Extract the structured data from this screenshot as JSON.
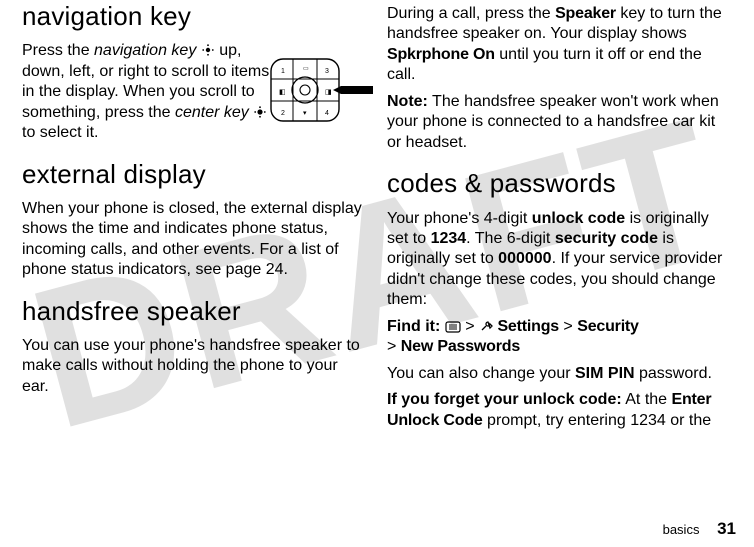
{
  "watermark": "DRAFT",
  "left": {
    "h_nav": "navigation key",
    "p_nav_1a": "Press the ",
    "p_nav_1b": "navigation key",
    "p_nav_1c": " up, down, left, or right to scroll to items in the display. When you scroll to something, press the ",
    "p_nav_1d": "center key",
    "p_nav_1e": " to select it.",
    "h_ext": "external display",
    "p_ext": "When your phone is closed, the external display shows the time and indicates phone status, incoming calls, and other events. For a list of phone status indicators, see page 24.",
    "h_hands": "handsfree speaker",
    "p_hands": "You can use your phone's handsfree speaker to make calls without holding the phone to your ear."
  },
  "right": {
    "p_speaker_a": "During a call, press the ",
    "p_speaker_b": "Speaker",
    "p_speaker_c": " key to turn the handsfree speaker on. Your display shows ",
    "p_speaker_d": "Spkrphone On",
    "p_speaker_e": " until you turn it off or end the call.",
    "p_note_a": "Note:",
    "p_note_b": " The handsfree speaker won't work when your phone is connected to a handsfree car kit or headset.",
    "h_codes": "codes & passwords",
    "p_codes_a": "Your phone's 4-digit ",
    "p_codes_b": "unlock code",
    "p_codes_c": " is originally set to ",
    "p_codes_d": "1234",
    "p_codes_e": ". The 6-digit ",
    "p_codes_f": "security code",
    "p_codes_g": " is originally set to ",
    "p_codes_h": "000000",
    "p_codes_i": ". If your service provider didn't change these codes, you should change them:",
    "p_find_a": "Find it:",
    "p_find_menu_sep1": " > ",
    "p_find_settings": "Settings",
    "p_find_sep2": " > ",
    "p_find_security": "Security",
    "p_find_sep3": " > ",
    "p_find_newpw": "New Passwords",
    "p_sim_a": "You can also change your ",
    "p_sim_b": "SIM PIN",
    "p_sim_c": " password.",
    "p_forget_a": "If you forget your unlock code:",
    "p_forget_b": " At the ",
    "p_forget_c": "Enter Unlock Code",
    "p_forget_d": " prompt, try entering 1234 or the"
  },
  "footer": {
    "section": "basics",
    "page": "31"
  },
  "icons": {
    "nav_dot": "nav-dot-icon",
    "center_key": "center-key-icon",
    "menu_key": "menu-key-icon",
    "tools": "tools-icon",
    "navpad": "navpad-diagram"
  }
}
